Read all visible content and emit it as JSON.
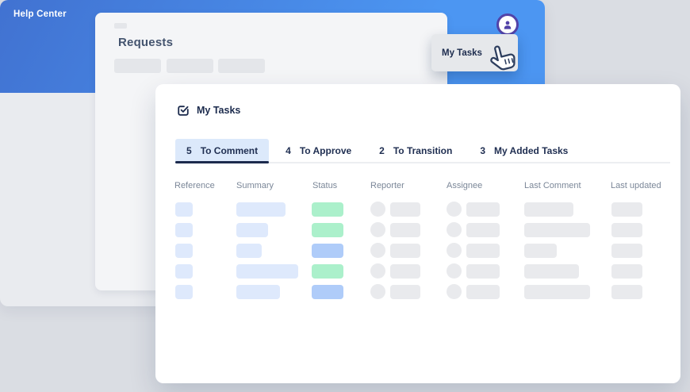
{
  "help_center": {
    "title": "Help Center"
  },
  "requests_card": {
    "title": "Requests"
  },
  "user_menu": {
    "label": "My Tasks"
  },
  "icons": {
    "avatar": "person-in-circle-icon",
    "panel": "task-checkbox-icon",
    "pointer": "hand-cursor-icon"
  },
  "tasks_panel": {
    "title": "My Tasks",
    "tabs": [
      {
        "count": "5",
        "label": "To Comment",
        "active": true
      },
      {
        "count": "4",
        "label": "To Approve",
        "active": false
      },
      {
        "count": "2",
        "label": "To Transition",
        "active": false
      },
      {
        "count": "3",
        "label": "My Added Tasks",
        "active": false
      }
    ],
    "table": {
      "columns": [
        "Reference",
        "Summary",
        "Status",
        "Reporter",
        "Assignee",
        "Last Comment",
        "Last updated"
      ],
      "rows": [
        {
          "summary_w": 62,
          "status": "green",
          "last_comment_w": 62
        },
        {
          "summary_w": 40,
          "status": "green",
          "last_comment_w": 83
        },
        {
          "summary_w": 32,
          "status": "blue",
          "last_comment_w": 41
        },
        {
          "summary_w": 78,
          "status": "green",
          "last_comment_w": 69
        },
        {
          "summary_w": 55,
          "status": "blue",
          "last_comment_w": 83
        }
      ],
      "status_colors": {
        "green": "#ABF0CB",
        "blue": "#AFCCF9"
      },
      "skeleton_colors": {
        "blue": "#DEE9FC",
        "gray": "#E9EAED"
      }
    }
  },
  "colors": {
    "header_gradient_start": "#4172D1",
    "header_gradient_end": "#4C96F2",
    "accent_purple": "#5243A8",
    "tab_active_bg": "#DCE9FB",
    "tab_underline": "#1C2B4D",
    "panel_bg": "#FFFFFF",
    "window_body_bg": "#E9EBEF",
    "page_bg": "#DADDE3"
  }
}
